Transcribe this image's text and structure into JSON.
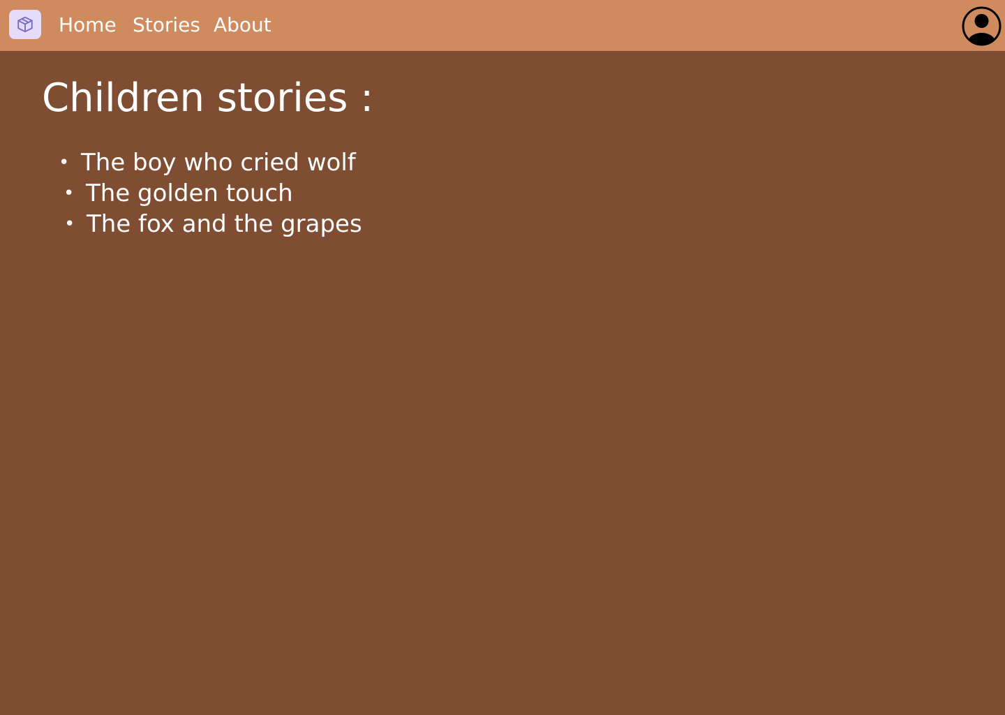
{
  "nav": {
    "logo_icon": "box-icon",
    "links": [
      {
        "label": "Home"
      },
      {
        "label": "Stories"
      },
      {
        "label": "About"
      }
    ],
    "profile_icon": "user-avatar-icon"
  },
  "main": {
    "title": "Children stories :",
    "stories": [
      {
        "title": "The boy who cried wolf"
      },
      {
        "title": "The golden touch"
      },
      {
        "title": "The fox and the grapes"
      }
    ]
  },
  "colors": {
    "navbar_bg": "#cf8b5e",
    "page_bg": "#7e4d32",
    "logo_bg": "#e5dcfb",
    "logo_icon": "#7a6fc4",
    "text": "#ffffff"
  }
}
